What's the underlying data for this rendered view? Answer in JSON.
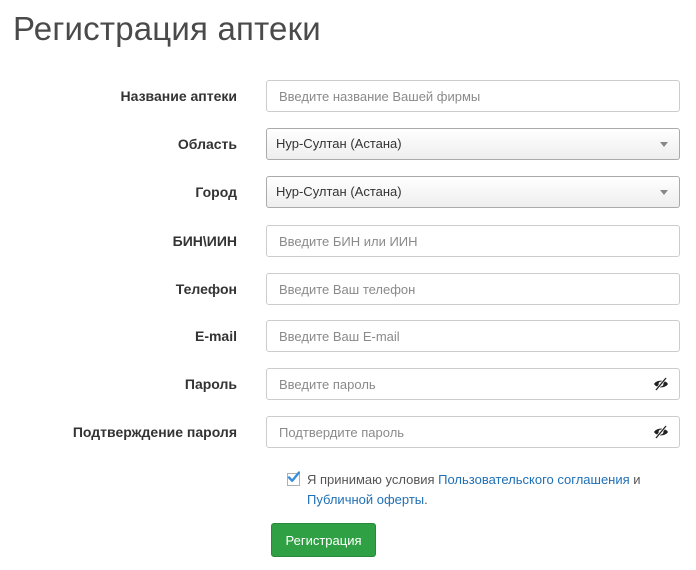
{
  "page": {
    "title": "Регистрация аптеки"
  },
  "form": {
    "pharmacy_name": {
      "label": "Название аптеки",
      "placeholder": "Введите название Вашей фирмы"
    },
    "region": {
      "label": "Область",
      "value": "Нур-Султан (Астана)"
    },
    "city": {
      "label": "Город",
      "value": "Нур-Султан (Астана)"
    },
    "bin": {
      "label": "БИН\\ИИН",
      "placeholder": "Введите БИН или ИИН"
    },
    "phone": {
      "label": "Телефон",
      "placeholder": "Введите Ваш телефон"
    },
    "email": {
      "label": "E-mail",
      "placeholder": "Введите Ваш E-mail"
    },
    "password": {
      "label": "Пароль",
      "placeholder": "Введите пароль"
    },
    "password_confirm": {
      "label": "Подтверждение пароля",
      "placeholder": "Подтвердите пароль"
    }
  },
  "agreement": {
    "checked": true,
    "text_before": "Я принимаю условия ",
    "link_user_agreement": "Пользовательского соглашения",
    "text_middle": " и ",
    "link_public_offer": "Публичной оферты",
    "text_after": "."
  },
  "submit": {
    "label": "Регистрация"
  },
  "colors": {
    "link": "#1f6fb5",
    "button": "#2fa043",
    "check": "#3a8fd8"
  },
  "icons": {
    "password_toggle": "eye-slash-icon",
    "dropdown": "caret-down-icon",
    "checkbox": "check-icon"
  }
}
